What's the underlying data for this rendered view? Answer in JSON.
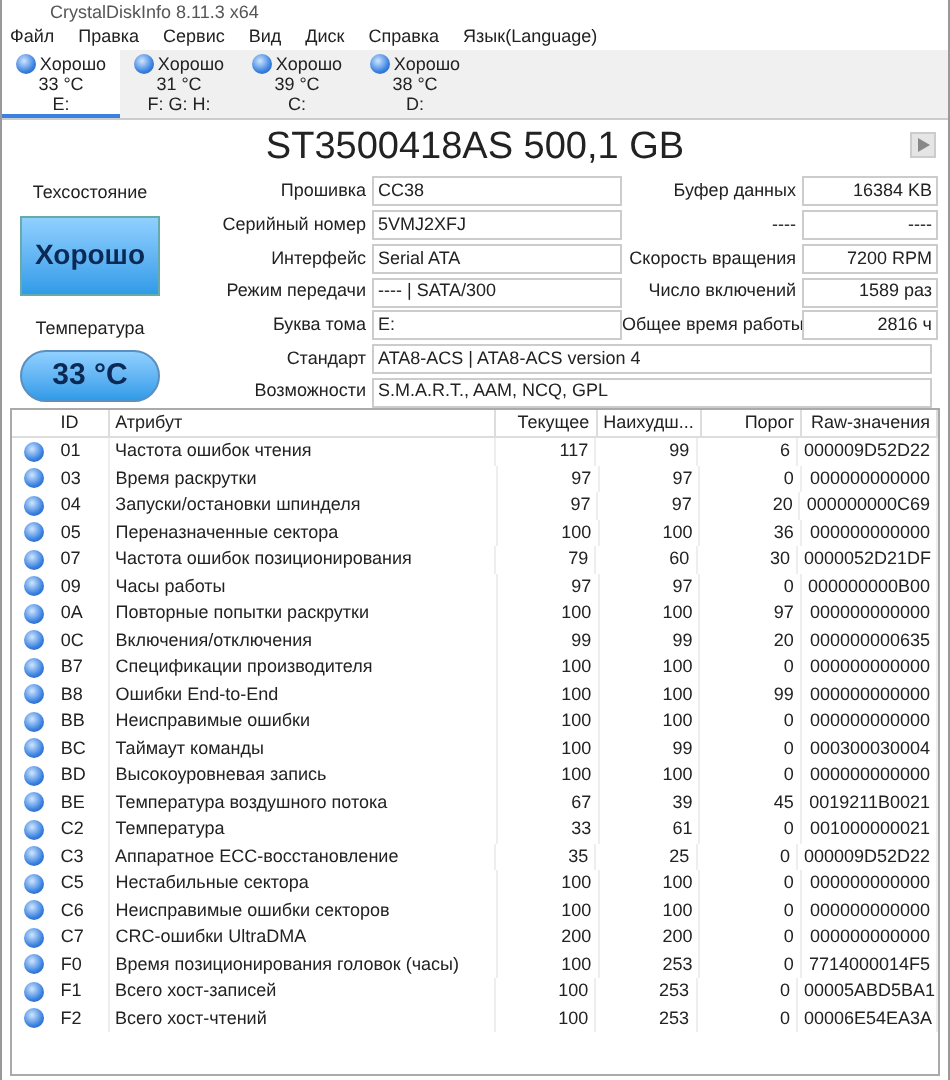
{
  "window": {
    "title": "CrystalDiskInfo 8.11.3 x64"
  },
  "menu": [
    "Файл",
    "Правка",
    "Сервис",
    "Вид",
    "Диск",
    "Справка",
    "Язык(Language)"
  ],
  "drives": [
    {
      "status": "Хорошо",
      "temp": "33 °C",
      "letters": "E:",
      "selected": true
    },
    {
      "status": "Хорошо",
      "temp": "31 °C",
      "letters": "F: G: H:",
      "selected": false
    },
    {
      "status": "Хорошо",
      "temp": "39 °C",
      "letters": "C:",
      "selected": false
    },
    {
      "status": "Хорошо",
      "temp": "38 °C",
      "letters": "D:",
      "selected": false
    }
  ],
  "model": "ST3500418AS 500,1 GB",
  "health": {
    "label": "Техсостояние",
    "value": "Хорошо"
  },
  "temperature": {
    "label": "Температура",
    "value": "33 °C"
  },
  "info": [
    {
      "label": "Прошивка",
      "value": "CC38",
      "right_label": "Буфер данных",
      "right_value": "16384 KB"
    },
    {
      "label": "Серийный номер",
      "value": "5VMJ2XFJ",
      "right_label": "----",
      "right_value": "----"
    },
    {
      "label": "Интерфейс",
      "value": "Serial ATA",
      "right_label": "Скорость вращения",
      "right_value": "7200 RPM"
    },
    {
      "label": "Режим передачи",
      "value": "---- | SATA/300",
      "right_label": "Число включений",
      "right_value": "1589 раз"
    },
    {
      "label": "Буква тома",
      "value": "E:",
      "right_label": "Общее время работы",
      "right_value": "2816 ч"
    },
    {
      "label": "Стандарт",
      "value": "ATA8-ACS | ATA8-ACS version 4"
    },
    {
      "label": "Возможности",
      "value": "S.M.A.R.T., AAM, NCQ, GPL"
    }
  ],
  "table": {
    "columns": [
      "ID",
      "Атрибут",
      "Текущее",
      "Наихудш...",
      "Порог",
      "Raw-значения"
    ],
    "rows": [
      [
        "01",
        "Частота ошибок чтения",
        "117",
        "99",
        "6",
        "000009D52D22"
      ],
      [
        "03",
        "Время раскрутки",
        "97",
        "97",
        "0",
        "000000000000"
      ],
      [
        "04",
        "Запуски/остановки шпинделя",
        "97",
        "97",
        "20",
        "000000000C69"
      ],
      [
        "05",
        "Переназначенные сектора",
        "100",
        "100",
        "36",
        "000000000000"
      ],
      [
        "07",
        "Частота ошибок позиционирования",
        "79",
        "60",
        "30",
        "0000052D21DF"
      ],
      [
        "09",
        "Часы работы",
        "97",
        "97",
        "0",
        "000000000B00"
      ],
      [
        "0A",
        "Повторные попытки раскрутки",
        "100",
        "100",
        "97",
        "000000000000"
      ],
      [
        "0C",
        "Включения/отключения",
        "99",
        "99",
        "20",
        "000000000635"
      ],
      [
        "B7",
        "Спецификации производителя",
        "100",
        "100",
        "0",
        "000000000000"
      ],
      [
        "B8",
        "Ошибки End-to-End",
        "100",
        "100",
        "99",
        "000000000000"
      ],
      [
        "BB",
        "Неисправимые ошибки",
        "100",
        "100",
        "0",
        "000000000000"
      ],
      [
        "BC",
        "Таймаут команды",
        "100",
        "99",
        "0",
        "000300030004"
      ],
      [
        "BD",
        "Высокоуровневая запись",
        "100",
        "100",
        "0",
        "000000000000"
      ],
      [
        "BE",
        "Температура воздушного потока",
        "67",
        "39",
        "45",
        "0019211B0021"
      ],
      [
        "C2",
        "Температура",
        "33",
        "61",
        "0",
        "001000000021"
      ],
      [
        "C3",
        "Аппаратное ECC-восстановление",
        "35",
        "25",
        "0",
        "000009D52D22"
      ],
      [
        "C5",
        "Нестабильные сектора",
        "100",
        "100",
        "0",
        "000000000000"
      ],
      [
        "C6",
        "Неисправимые ошибки секторов",
        "100",
        "100",
        "0",
        "000000000000"
      ],
      [
        "C7",
        "CRC-ошибки UltraDMA",
        "200",
        "200",
        "0",
        "000000000000"
      ],
      [
        "F0",
        "Время позиционирования головок (часы)",
        "100",
        "253",
        "0",
        "7714000014F5"
      ],
      [
        "F1",
        "Всего хост-записей",
        "100",
        "253",
        "0",
        "00005ABD5BA1"
      ],
      [
        "F2",
        "Всего хост-чтений",
        "100",
        "253",
        "0",
        "00006E54EA3A"
      ]
    ]
  }
}
